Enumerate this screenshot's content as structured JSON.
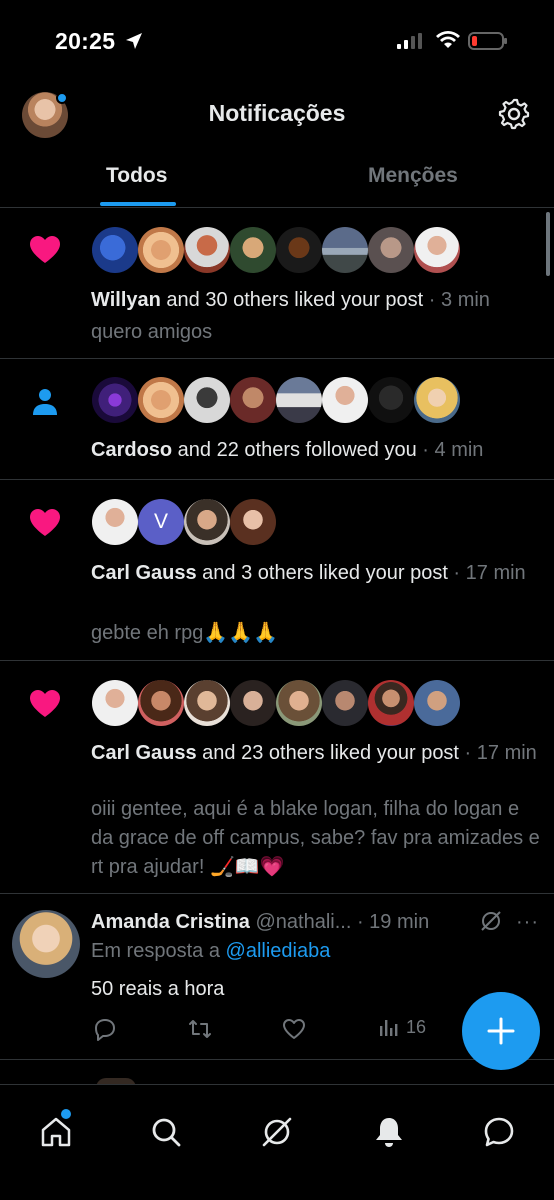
{
  "status_bar": {
    "time": "20:25"
  },
  "header": {
    "title": "Notificações"
  },
  "tabs": [
    {
      "label": "Todos"
    },
    {
      "label": "Menções"
    }
  ],
  "notifications": [
    {
      "type": "like",
      "actor": "Willyan",
      "action": " and 30 others liked your post",
      "time": " · 3 min",
      "preview": "quero amigos",
      "avatar_count": 8
    },
    {
      "type": "follow",
      "actor": "Cardoso",
      "action": " and 22 others followed you",
      "time": " · 4 min",
      "avatar_count": 8
    },
    {
      "type": "like",
      "actor": "Carl Gauss",
      "action": " and 3 others liked your post",
      "time": " · 17 min",
      "preview": "gebte eh rpg🙏🙏🙏",
      "avatar_letter": "V",
      "avatar_count": 4
    },
    {
      "type": "like",
      "actor": "Carl Gauss",
      "action": " and 23 others liked your post",
      "time": " · 17 min",
      "preview": "oiii gentee, aqui é a blake logan, filha do logan e da grace de off campus, sabe? fav pra amizades e rt pra ajudar! 🏒📖💗",
      "avatar_count": 8
    }
  ],
  "tweet": {
    "name": "Amanda Cristina",
    "handle": " @nathali...",
    "time": " · 19 min",
    "reply_prefix": "Em resposta a ",
    "reply_handle": "@alliediaba",
    "text": "50 reais a hora",
    "views": "16"
  },
  "icons": {
    "accent": "#1d9bf0",
    "like": "#f91880",
    "nav": [
      "home-icon",
      "search-icon",
      "grok-icon",
      "bell-icon",
      "messages-icon"
    ]
  }
}
